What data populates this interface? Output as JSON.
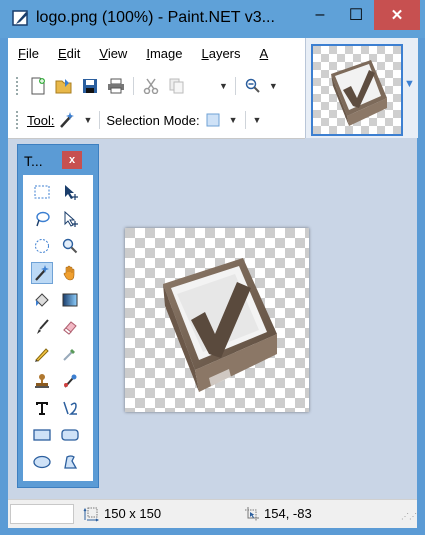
{
  "window": {
    "title": "logo.png (100%) - Paint.NET v3...",
    "minimize_glyph": "–",
    "maximize_glyph": "☐",
    "close_glyph": "✕"
  },
  "menu": {
    "items": [
      "File",
      "Edit",
      "View",
      "Image",
      "Layers",
      "A"
    ],
    "mnemonic_first": [
      "F",
      "E",
      "V",
      "I",
      "L",
      "A"
    ],
    "rest": [
      "ile",
      "dit",
      "iew",
      "mage",
      "ayers",
      ""
    ]
  },
  "toolbar": {
    "tool_label": "Tool:",
    "selection_mode_label": "Selection Mode:"
  },
  "tools_panel": {
    "title": "T...",
    "close_glyph": "x",
    "tools": [
      "rectangle-select",
      "move-selected-pixels",
      "lasso-select",
      "move-selection",
      "ellipse-select",
      "zoom",
      "magic-wand",
      "pan",
      "paint-bucket",
      "gradient",
      "paintbrush",
      "eraser",
      "pencil",
      "color-picker",
      "clone-stamp",
      "recolor",
      "text",
      "line-curve",
      "rectangle",
      "rounded-rectangle",
      "ellipse",
      "freeform-shape"
    ],
    "selected_tool": "magic-wand"
  },
  "status": {
    "image_size": "150 x 150",
    "cursor_position": "154, -83"
  },
  "colors": {
    "accent": "#5b9bd5",
    "close_red": "#c75050",
    "workspace": "#c9d5e6"
  }
}
